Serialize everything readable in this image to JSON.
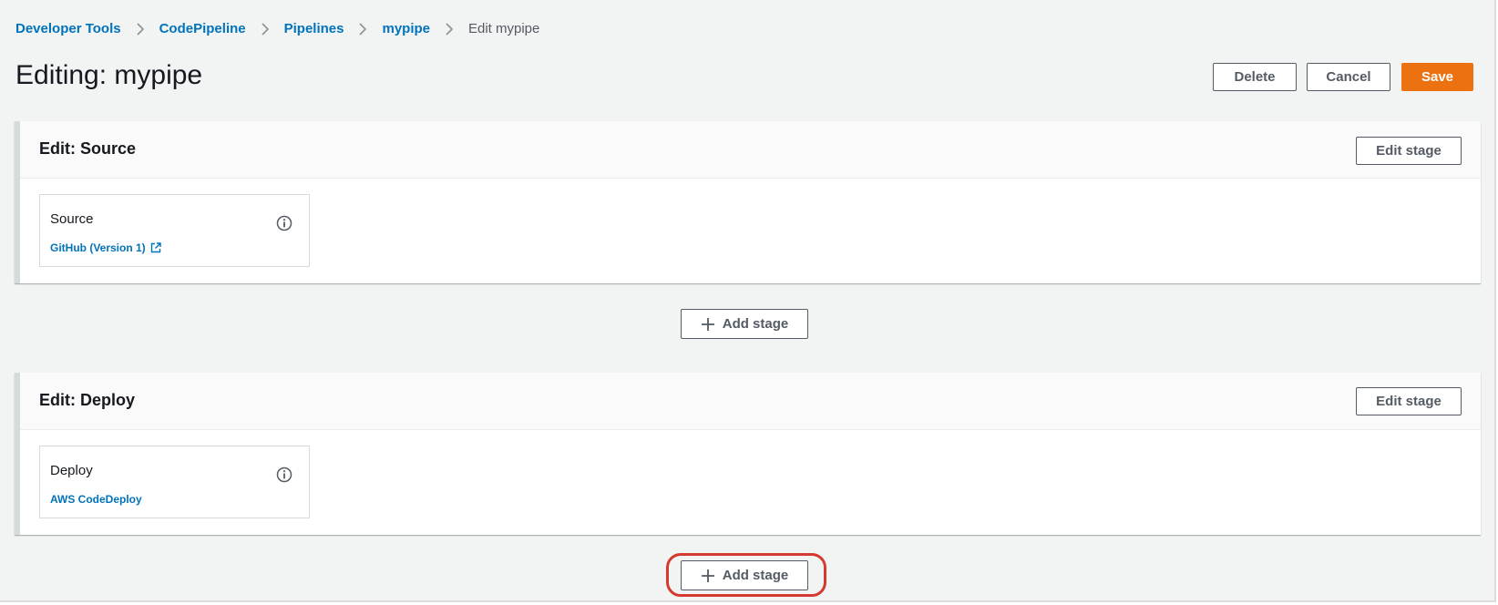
{
  "breadcrumb": {
    "items": [
      "Developer Tools",
      "CodePipeline",
      "Pipelines",
      "mypipe"
    ],
    "current": "Edit mypipe"
  },
  "page": {
    "title": "Editing: mypipe"
  },
  "header_actions": {
    "delete_label": "Delete",
    "cancel_label": "Cancel",
    "save_label": "Save"
  },
  "stages": [
    {
      "title": "Edit: Source",
      "edit_label": "Edit stage",
      "action": {
        "name": "Source",
        "provider": "GitHub (Version 1)",
        "provider_external_link": true
      }
    },
    {
      "title": "Edit: Deploy",
      "edit_label": "Edit stage",
      "action": {
        "name": "Deploy",
        "provider": "AWS CodeDeploy",
        "provider_external_link": false
      }
    }
  ],
  "add_stage_buttons": [
    {
      "label": "Add stage",
      "highlighted": false
    },
    {
      "label": "Add stage",
      "highlighted": true
    }
  ],
  "colors": {
    "link": "#0073bb",
    "primary_button": "#ec7211",
    "highlight_ring": "#d43a2f",
    "page_background": "#f2f3f3"
  },
  "icons": {
    "breadcrumb_separator": "chevron-right-icon",
    "info": "info-icon",
    "external_link": "external-link-icon",
    "add": "plus-icon"
  }
}
